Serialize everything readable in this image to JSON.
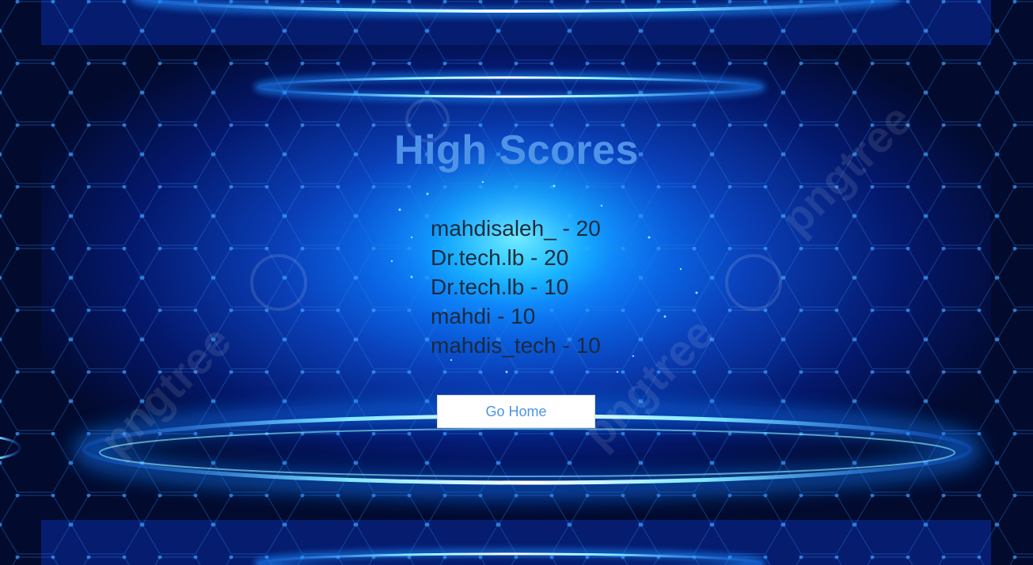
{
  "page": {
    "title": "High Scores"
  },
  "scores": [
    {
      "text": "mahdisaleh_ - 20"
    },
    {
      "text": "Dr.tech.lb - 20"
    },
    {
      "text": "Dr.tech.lb - 10"
    },
    {
      "text": "mahdi - 10"
    },
    {
      "text": "mahdis_tech - 10"
    }
  ],
  "actions": {
    "home_label": "Go Home"
  },
  "colors": {
    "background": "#020a2e",
    "glow": "#0a7bff",
    "title": "#4f93e8",
    "score_text": "#1c2a3e",
    "button_bg": "#ffffff",
    "button_text": "#4f93e8"
  },
  "background": {
    "watermark_text": "pngtree"
  }
}
